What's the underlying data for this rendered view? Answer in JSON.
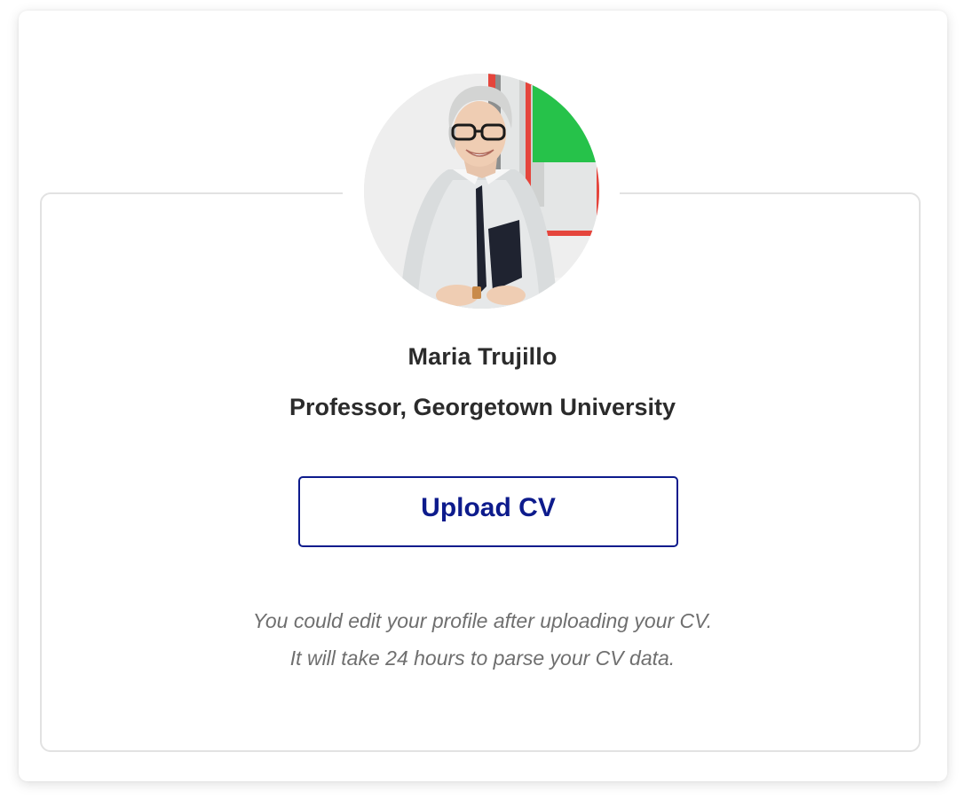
{
  "profile": {
    "name": "Maria Trujillo",
    "title": "Professor, Georgetown University",
    "avatar_icon": "profile-photo"
  },
  "actions": {
    "upload_label": "Upload CV"
  },
  "notes": {
    "line1": "You could edit your profile after uploading your CV.",
    "line2": "It will take 24 hours to parse your CV data."
  },
  "colors": {
    "accent": "#0d1b8c",
    "text_dark": "#2b2b2b",
    "text_muted": "#6f6f6f",
    "panel_border": "#e2e2e2"
  }
}
